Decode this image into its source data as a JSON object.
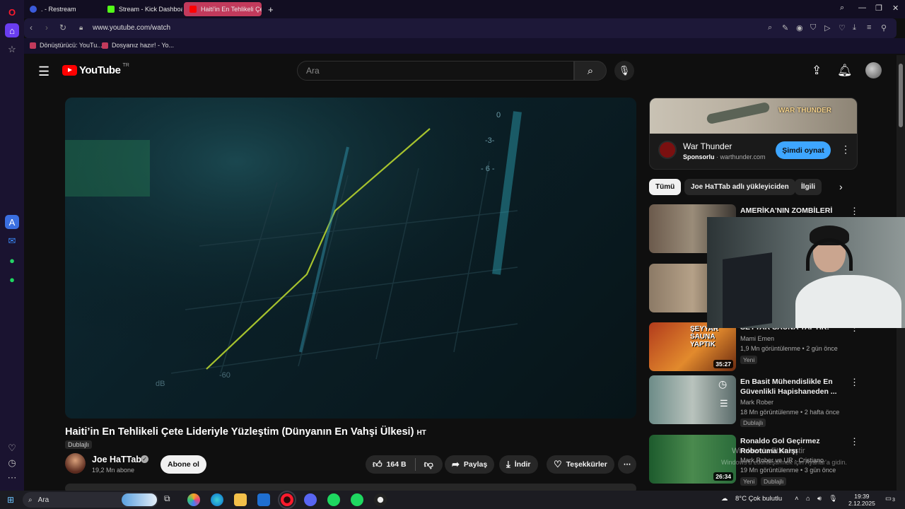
{
  "browser": {
    "tabs": [
      {
        "label": ". - Restream",
        "active": false
      },
      {
        "label": "Stream - Kick Dashboard",
        "active": false
      },
      {
        "label": "Haiti'in En Tehlikeli Çete Li",
        "active": true
      }
    ],
    "url": "www.youtube.com/watch",
    "bookmarks": [
      "Dönüştürücü: YouTu...",
      "Dosyanız hazır! - Yo..."
    ]
  },
  "youtube": {
    "logo_word": "YouTube",
    "country_code": "TR",
    "search_placeholder": "Ara",
    "video": {
      "title": "Haiti’in En Tehlikeli Çete Lideriyle Yüzleştim (Dünyanın En Vahşi Ülkesi)",
      "title_suffix": "HT",
      "dub_label": "Dublajlı",
      "channel": "Joe HaTTab",
      "subscribers": "19,2 Mn abone",
      "subscribe_label": "Abone ol",
      "likes": "164 B",
      "share_label": "Paylaş",
      "download_label": "İndir",
      "thanks_label": "Teşekkürler",
      "overlay_labels": [
        "-60",
        "dB",
        "- 6 -",
        "0",
        "-3-"
      ]
    },
    "ad": {
      "title": "War Thunder",
      "sponsored": "Sponsorlu",
      "domain": "warthunder.com",
      "cta": "Şimdi oynat",
      "banner_text": "WAR THUNDER"
    },
    "chips": [
      "Tümü",
      "Joe HaTTab adlı yükleyiciden",
      "İlgili"
    ],
    "recommendations": [
      {
        "title": "AMERİKA'NIN ZOMBİLERİ",
        "channel": "",
        "meta": "",
        "duration": "",
        "badges": []
      },
      {
        "title": "",
        "channel": "",
        "meta": "",
        "duration": "",
        "badges": []
      },
      {
        "title": "SEYYAR SAUNA YAPTIK!",
        "channel": "Mami Emen",
        "meta": "1,9 Mn görüntülenme • 2 gün önce",
        "duration": "35:27",
        "badges": [
          "Yeni"
        ]
      },
      {
        "title": "En Basit Mühendislikle En Güvenlikli Hapishaneden ...",
        "channel": "Mark Rober",
        "meta": "18 Mn görüntülenme • 2 hafta önce",
        "duration": "",
        "badges": [
          "Dublajlı"
        ]
      },
      {
        "title": "Ronaldo Gol Geçirmez Robotuma Karşı",
        "channel": "Mark Rober ve UR · Cristiano",
        "meta": "19 Mn görüntülenme • 3 gün önce",
        "duration": "26:34",
        "badges": [
          "Yeni",
          "Dublajlı"
        ]
      }
    ],
    "thumb_text": "ŞEYYAR SAUNA YAPTIK"
  },
  "windows": {
    "activate_title": "Windows'u Etkinleştir",
    "activate_hint": "Windows'u etkinleştirmek için Ayarlar'a gidin.",
    "taskbar_search": "Ara",
    "weather": "8°C  Çok bulutlu",
    "time": "19:39",
    "date": "2.12.2025",
    "notification_count": "3"
  }
}
